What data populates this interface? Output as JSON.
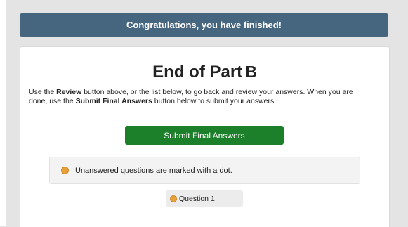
{
  "banner": {
    "text": "Congratulations, you have finished!"
  },
  "card": {
    "title": "End of Part",
    "part_letter": "B",
    "instructions": {
      "line1_pre": "Use the ",
      "review_bold": "Review",
      "line1_post": " button above, or the list below, to go back and review your answers. When you are done, use the ",
      "submit_bold": "Submit Final Answers",
      "line2_post": " button below to submit your answers."
    },
    "submit_button_label": "Submit Final Answers",
    "legend_text": "Unanswered questions are marked with a dot.",
    "questions": [
      {
        "label": "Question 1",
        "unanswered": true
      }
    ]
  },
  "colors": {
    "banner_bg": "#46657e",
    "submit_bg": "#1c7f2a",
    "dot": "#e8a13a",
    "page_bg": "#e4e4e4"
  }
}
